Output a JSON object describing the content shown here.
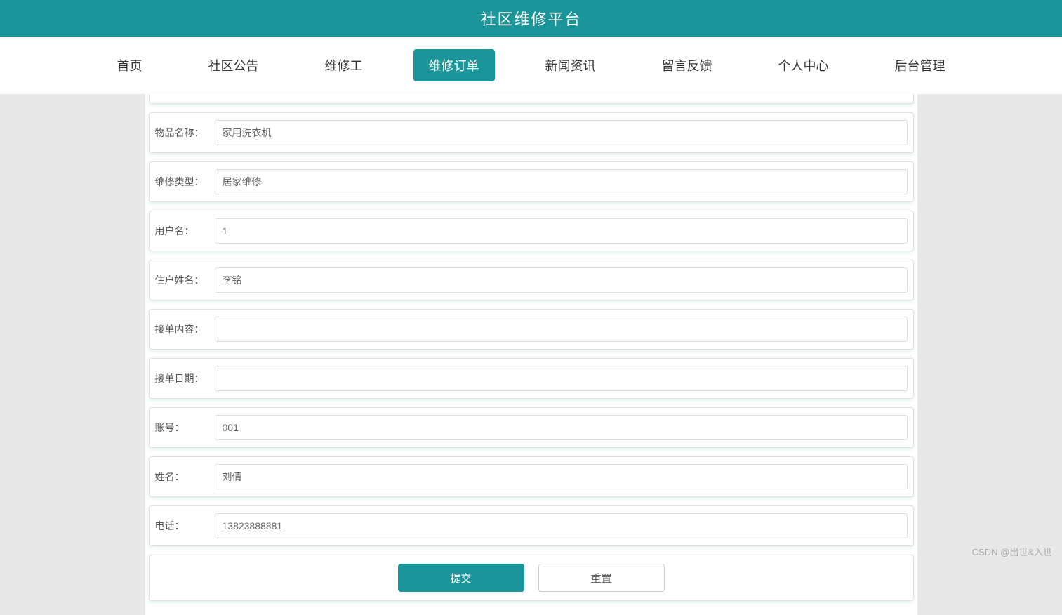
{
  "header": {
    "title": "社区维修平台"
  },
  "nav": {
    "items": [
      "首页",
      "社区公告",
      "维修工",
      "维修订单",
      "新闻资讯",
      "留言反馈",
      "个人中心",
      "后台管理"
    ],
    "activeIndex": 3
  },
  "form": {
    "fields": [
      {
        "label": "物品名称：",
        "value": "家用洗衣机"
      },
      {
        "label": "维修类型：",
        "value": "居家维修"
      },
      {
        "label": "用户名：",
        "value": "1"
      },
      {
        "label": "住户姓名：",
        "value": "李铭"
      },
      {
        "label": "接单内容：",
        "value": ""
      },
      {
        "label": "接单日期：",
        "value": ""
      },
      {
        "label": "账号：",
        "value": "001"
      },
      {
        "label": "姓名：",
        "value": "刘倩"
      },
      {
        "label": "电话：",
        "value": "13823888881"
      }
    ],
    "buttons": {
      "submit": "提交",
      "reset": "重置"
    }
  },
  "watermark": "CSDN @出世&入世"
}
